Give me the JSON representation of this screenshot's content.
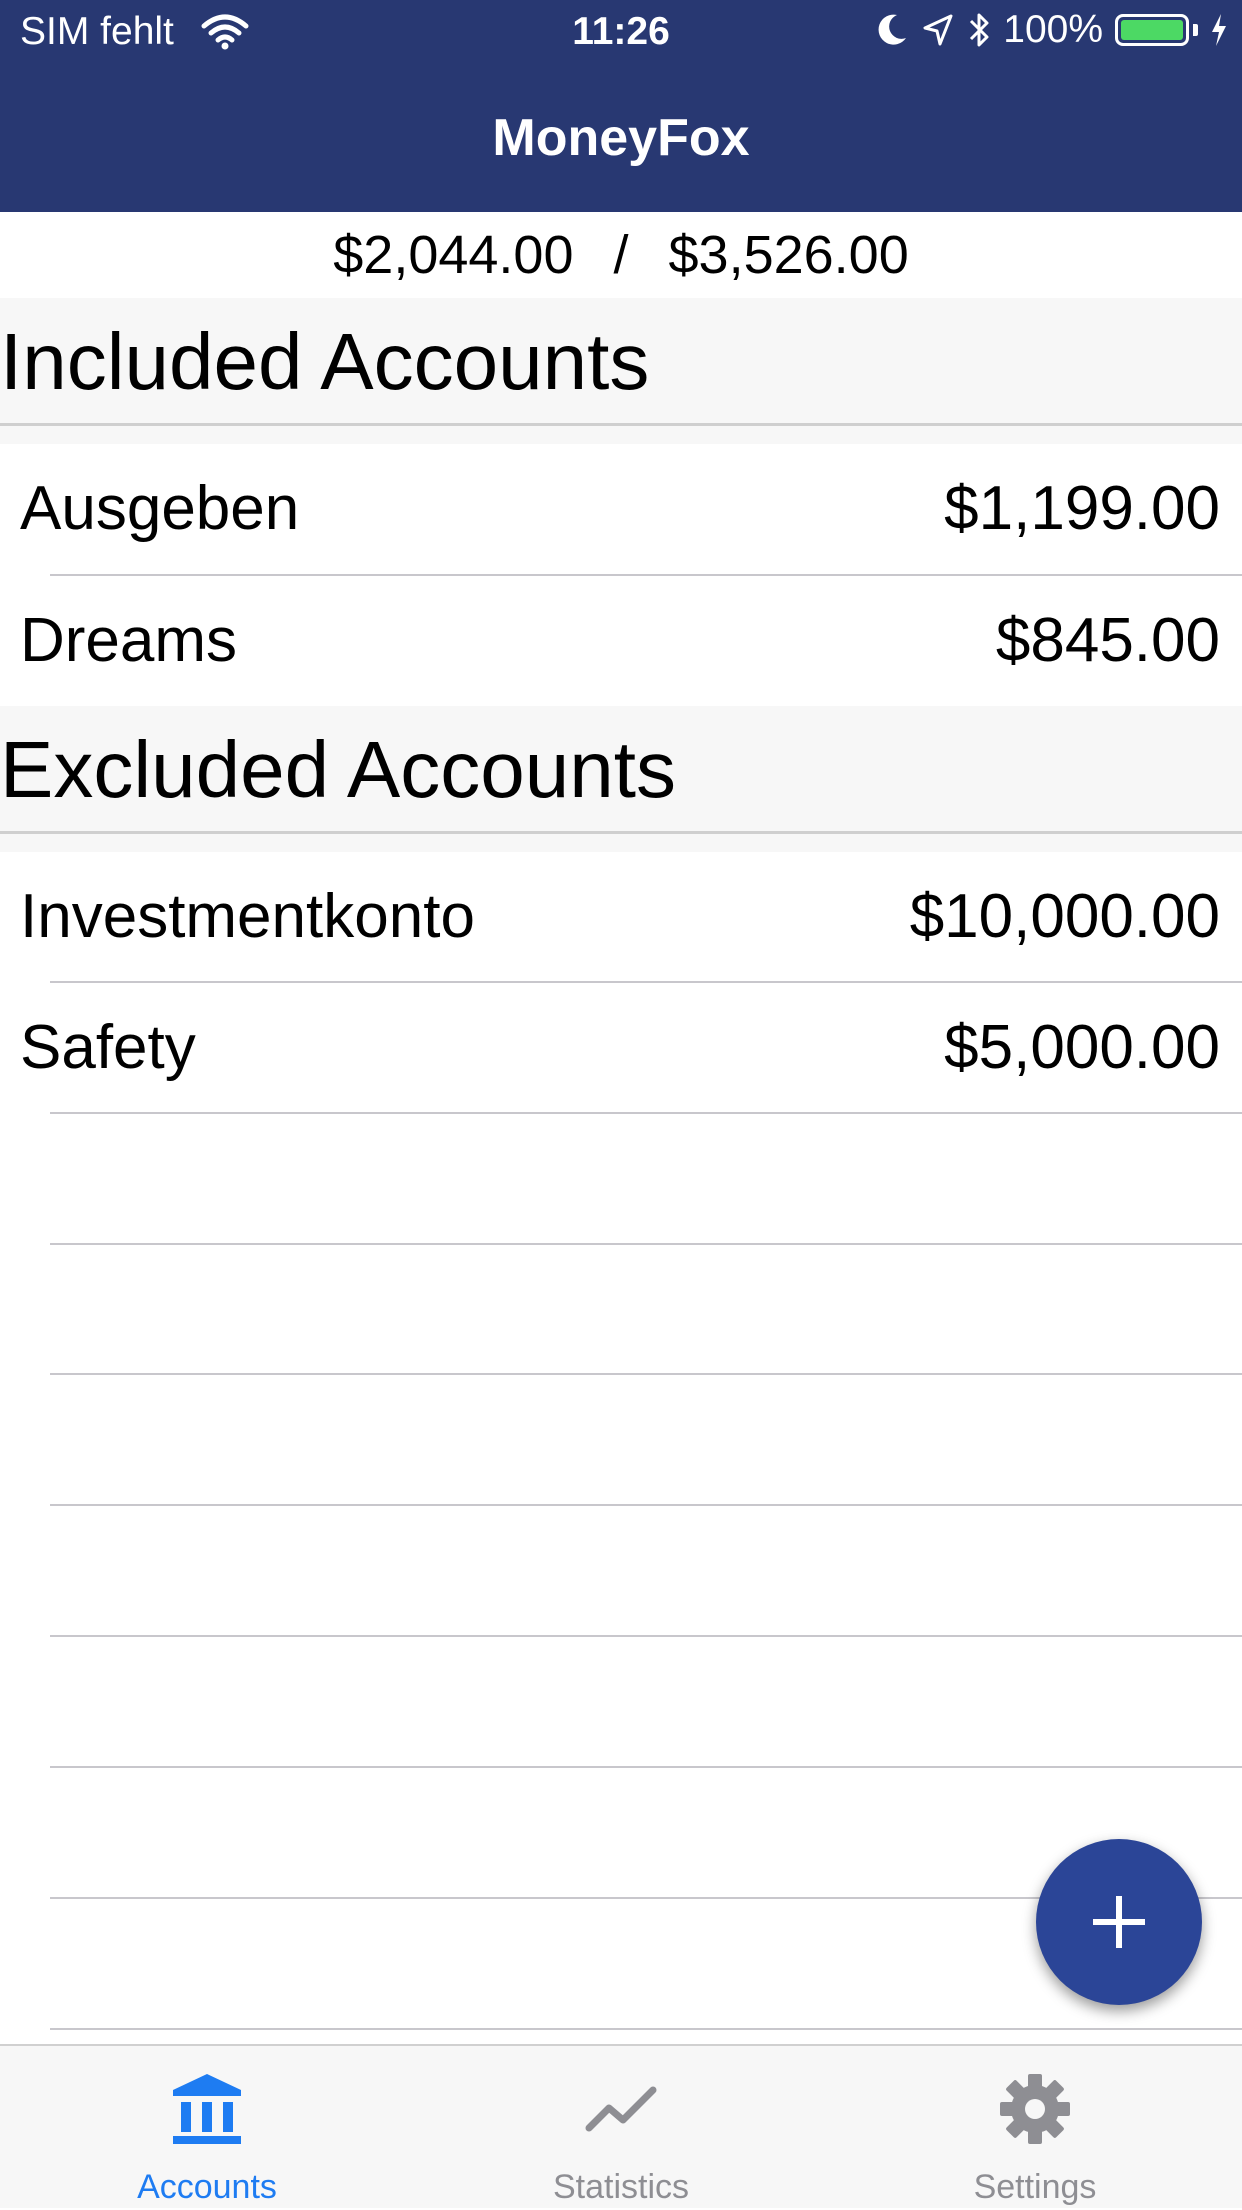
{
  "status_bar": {
    "carrier": "SIM fehlt",
    "time": "11:26",
    "battery": "100%"
  },
  "header": {
    "title": "MoneyFox"
  },
  "totals": {
    "left": "$2,044.00",
    "divider": "/",
    "right": "$3,526.00"
  },
  "sections": [
    {
      "title": "Included Accounts",
      "accounts": [
        {
          "name": "Ausgeben",
          "amount": "$1,199.00"
        },
        {
          "name": "Dreams",
          "amount": "$845.00"
        }
      ]
    },
    {
      "title": "Excluded Accounts",
      "accounts": [
        {
          "name": "Investmentkonto",
          "amount": "$10,000.00"
        },
        {
          "name": "Safety",
          "amount": "$5,000.00"
        }
      ]
    }
  ],
  "fab": {
    "icon": "plus-icon"
  },
  "tabs": [
    {
      "label": "Accounts",
      "icon": "bank-icon",
      "selected": true
    },
    {
      "label": "Statistics",
      "icon": "chart-line-icon",
      "selected": false
    },
    {
      "label": "Settings",
      "icon": "gear-icon",
      "selected": false
    }
  ],
  "colors": {
    "header_bg": "#283872",
    "fab_bg": "#2b4597",
    "tab_active": "#1e7cf2",
    "tab_inactive": "#8e8e93",
    "battery_green": "#4cd964"
  }
}
